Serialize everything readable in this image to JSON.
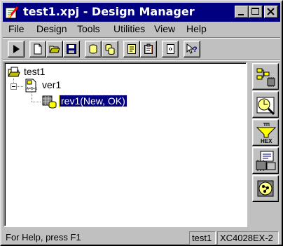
{
  "window": {
    "title": "test1.xpj - Design Manager"
  },
  "title_buttons": [
    "minimize",
    "maximize",
    "close"
  ],
  "menu": {
    "items": [
      {
        "label": "File"
      },
      {
        "label": "Design"
      },
      {
        "label": "Tools"
      },
      {
        "label": "Utilities"
      },
      {
        "label": "View"
      },
      {
        "label": "Help"
      }
    ]
  },
  "toolbar": {
    "buttons": [
      {
        "icon": "play-icon"
      },
      {
        "icon": "new-file-icon"
      },
      {
        "icon": "open-folder-icon"
      },
      {
        "icon": "save-disk-icon"
      },
      {
        "icon": "cylinder-icon"
      },
      {
        "icon": "cylinders-icon"
      },
      {
        "icon": "report-icon"
      },
      {
        "icon": "clipboard-icon"
      },
      {
        "icon": "page-arrows-icon"
      },
      {
        "icon": "context-help-icon"
      }
    ]
  },
  "tree": {
    "project": "test1",
    "version": "ver1",
    "revision": "rev1(New, OK)"
  },
  "flow_buttons": [
    {
      "icon": "design-entry-icon"
    },
    {
      "icon": "simulation-timer-icon"
    },
    {
      "icon": "hex-prom-icon",
      "text": "HEX"
    },
    {
      "icon": "chip-programmer-icon"
    },
    {
      "icon": "timing-analyzer-icon"
    }
  ],
  "status": {
    "help_text": "For Help, press F1",
    "project": "test1",
    "device": "XC4028EX-2"
  },
  "colors": {
    "titlebar": "#000080",
    "face": "#c0c0c0",
    "selection": "#000080"
  }
}
